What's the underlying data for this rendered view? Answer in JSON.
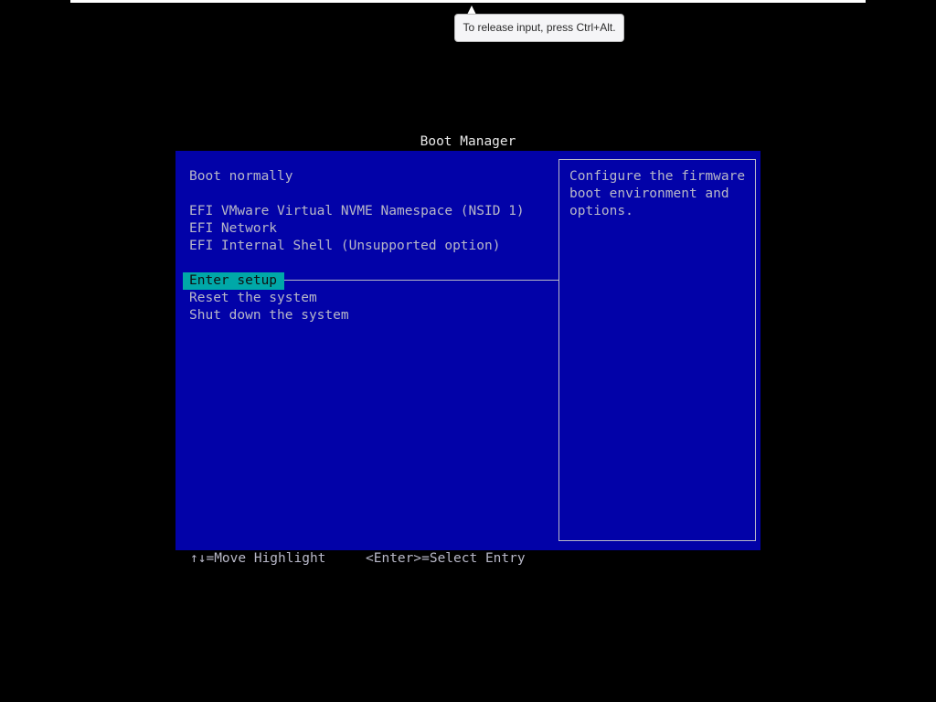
{
  "tooltip": {
    "text": "To release input, press Ctrl+Alt."
  },
  "boot_manager": {
    "title": "Boot Manager",
    "menu_items": [
      {
        "label": "Boot normally"
      },
      {
        "label": "EFI VMware Virtual NVME Namespace (NSID 1)"
      },
      {
        "label": "EFI Network"
      },
      {
        "label": "EFI Internal Shell (Unsupported option)"
      },
      {
        "label": "Enter setup",
        "selected": true
      },
      {
        "label": "Reset the system"
      },
      {
        "label": "Shut down the system"
      }
    ],
    "help_text": "Configure the firmware boot environment and options."
  },
  "footer": {
    "move_hint": "↑↓=Move Highlight",
    "select_hint": "<Enter>=Select Entry"
  },
  "colors": {
    "background": "#000000",
    "panel": "#0202a8",
    "text": "#b8b8c8",
    "highlight": "#00a8a8"
  }
}
